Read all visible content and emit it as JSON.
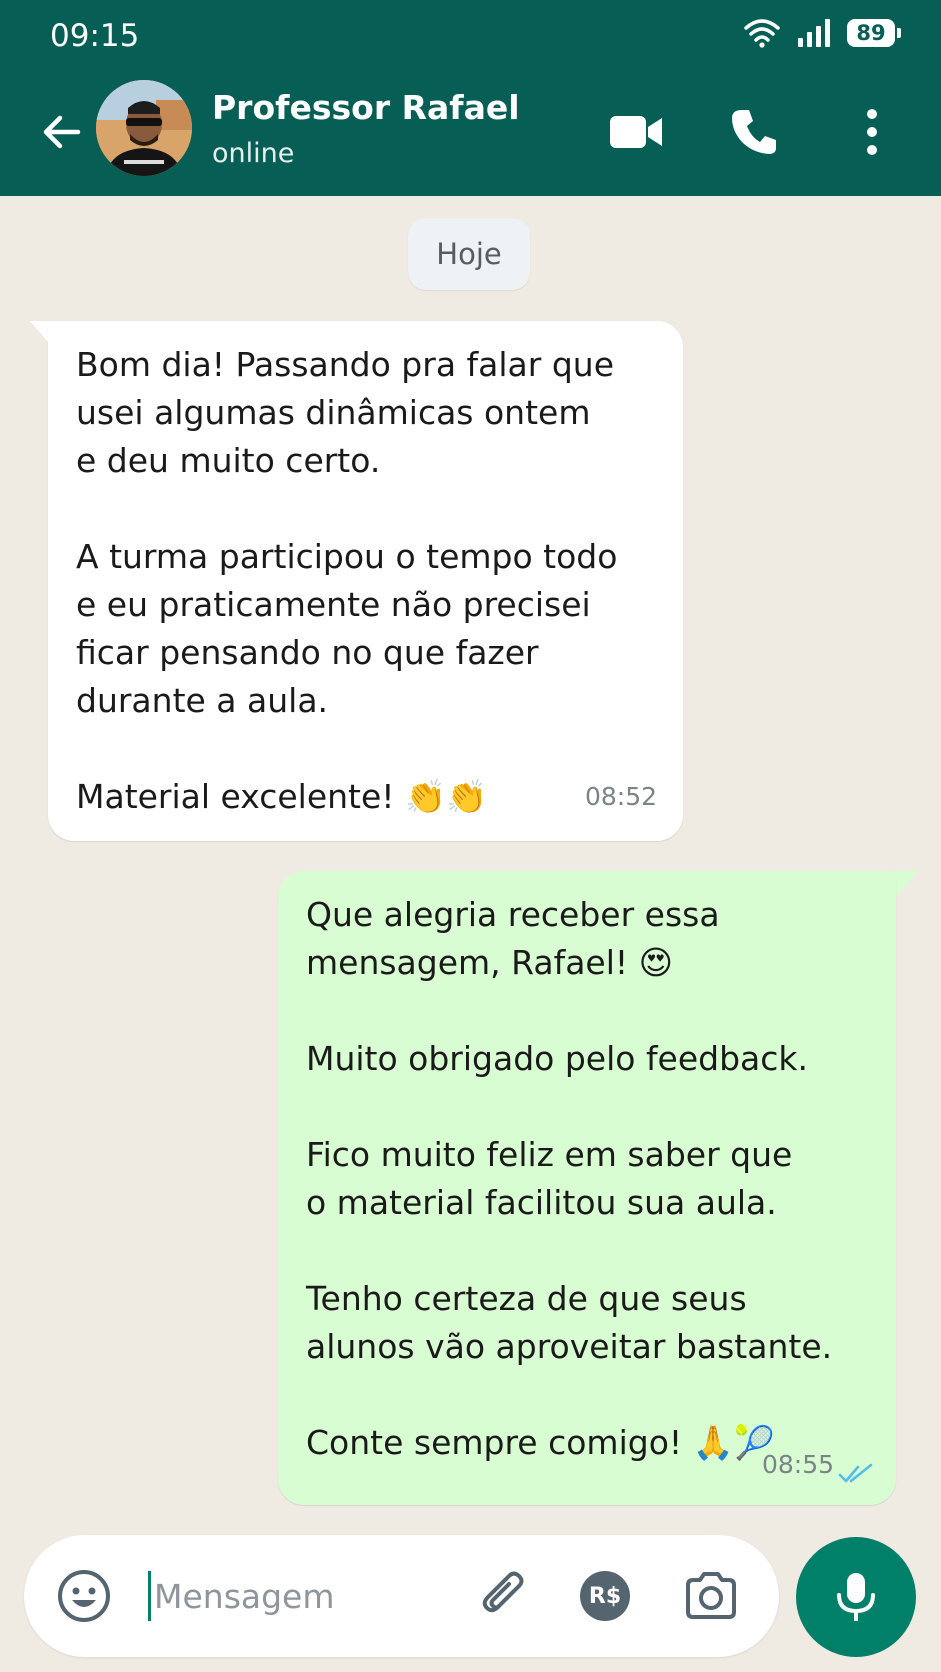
{
  "status_bar": {
    "time": "09:15",
    "battery": "89",
    "icons": [
      "wifi-icon",
      "signal-icon",
      "battery-icon"
    ]
  },
  "header": {
    "contact_name": "Professor Rafael",
    "contact_status": "online",
    "icons": [
      "back-arrow-icon",
      "video-call-icon",
      "phone-icon",
      "more-vertical-icon"
    ],
    "color": "#075e54"
  },
  "chat": {
    "day_label": "Hoje",
    "messages": [
      {
        "direction": "incoming",
        "text": "Bom dia! Passando pra falar que\nusei algumas dinâmicas ontem\ne deu muito certo.\n\nA turma participou o tempo todo\ne eu praticamente não precisei\nficar pensando no que fazer\ndurante a aula.\n\nMaterial excelente! 👏👏",
        "time": "08:52"
      },
      {
        "direction": "outgoing",
        "text": "Que alegria receber essa\nmensagem, Rafael! 😍\n\nMuito obrigado pelo feedback.\n\nFico muito feliz em saber que\no material facilitou sua aula.\n\nTenho certeza de que seus\nalunos vão aproveitar bastante.\n\nConte sempre comigo! 🙏🎾",
        "time": "08:55",
        "status": "read"
      }
    ]
  },
  "composer": {
    "placeholder": "Mensagem",
    "pay_label": "R$",
    "icons": [
      "emoji-icon",
      "paperclip-icon",
      "payment-icon",
      "camera-icon",
      "microphone-icon"
    ],
    "accent": "#008069"
  }
}
